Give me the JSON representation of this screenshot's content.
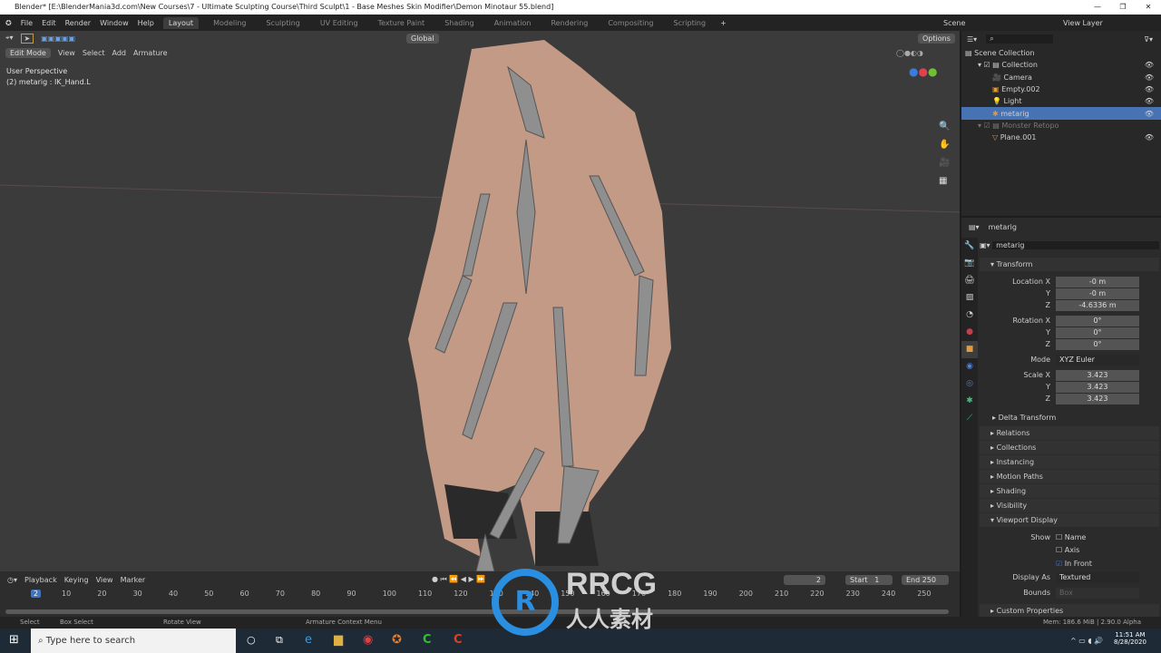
{
  "window": {
    "title": "Blender* [E:\\BlenderMania3d.com\\New Courses\\7 - Ultimate Sculpting Course\\Third Sculpt\\1 - Base Meshes Skin Modifier\\Demon Minotaur 55.blend]"
  },
  "menu": [
    "File",
    "Edit",
    "Render",
    "Window",
    "Help"
  ],
  "workspaces": [
    "Layout",
    "Modeling",
    "Sculpting",
    "UV Editing",
    "Texture Paint",
    "Shading",
    "Animation",
    "Rendering",
    "Compositing",
    "Scripting"
  ],
  "scene": "Scene",
  "view_layer": "View Layer",
  "viewport": {
    "mode": "Edit Mode",
    "menus": [
      "View",
      "Select",
      "Add",
      "Armature"
    ],
    "orientation": "Global",
    "options": "Options",
    "overlay1": "User Perspective",
    "overlay2": "(2) metarig : IK_Hand.L"
  },
  "outliner": {
    "root": "Scene Collection",
    "items": [
      {
        "label": "Collection",
        "icon": "collection-icon"
      },
      {
        "label": "Camera",
        "icon": "camera-icon"
      },
      {
        "label": "Empty.002",
        "icon": "empty-icon"
      },
      {
        "label": "Light",
        "icon": "light-icon"
      },
      {
        "label": "metarig",
        "icon": "armature-icon",
        "selected": true
      },
      {
        "label": "Monster Retopo",
        "icon": "collection-icon"
      },
      {
        "label": "Plane.001",
        "icon": "mesh-icon"
      }
    ]
  },
  "properties": {
    "header": "metarig",
    "name": "metarig",
    "transform": "Transform",
    "rows": [
      {
        "label": "Location X",
        "value": "-0 m"
      },
      {
        "label": "Y",
        "value": "-0 m"
      },
      {
        "label": "Z",
        "value": "-4.6336 m"
      },
      {
        "label": "Rotation X",
        "value": "0°"
      },
      {
        "label": "Y",
        "value": "0°"
      },
      {
        "label": "Z",
        "value": "0°"
      },
      {
        "label": "Mode",
        "value": "XYZ Euler"
      },
      {
        "label": "Scale X",
        "value": "3.423"
      },
      {
        "label": "Y",
        "value": "3.423"
      },
      {
        "label": "Z",
        "value": "3.423"
      }
    ],
    "delta": "Delta Transform",
    "sections": [
      "Relations",
      "Collections",
      "Instancing",
      "Motion Paths",
      "Shading",
      "Visibility",
      "Viewport Display"
    ],
    "show": "Show",
    "show_opts": [
      {
        "label": "Name",
        "checked": false
      },
      {
        "label": "Axis",
        "checked": false
      },
      {
        "label": "In Front",
        "checked": true
      }
    ],
    "display_as_label": "Display As",
    "display_as": "Textured",
    "bounds_label": "Bounds",
    "bounds": "Box",
    "custom": "Custom Properties"
  },
  "timeline": {
    "menus": [
      "Playback",
      "Keying",
      "View",
      "Marker"
    ],
    "current": "2",
    "start_label": "Start",
    "start": "1",
    "end_label": "End",
    "end": "250",
    "ticks": [
      "10",
      "20",
      "30",
      "40",
      "50",
      "60",
      "70",
      "80",
      "90",
      "100",
      "110",
      "120",
      "130",
      "140",
      "150",
      "160",
      "170",
      "180",
      "190",
      "200",
      "210",
      "220",
      "230",
      "240",
      "250"
    ]
  },
  "status": {
    "select": "Select",
    "box": "Box Select",
    "rotate": "Rotate View",
    "context": "Armature Context Menu",
    "mem": "Mem: 186.6 MiB | 2.90.0 Alpha"
  },
  "taskbar": {
    "search": "Type here to search",
    "time": "11:51 AM",
    "date": "8/28/2020"
  },
  "watermark": "RRCG 人人素材"
}
